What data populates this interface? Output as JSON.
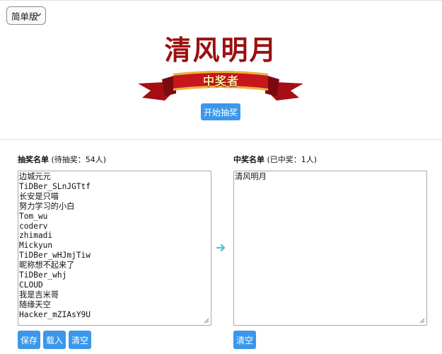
{
  "mode_select": {
    "value": "简单版"
  },
  "winner_display": {
    "name": "清风明月",
    "banner_text": "中奖者"
  },
  "start_button": "开始抽奖",
  "pool": {
    "title": "抽奖名单",
    "status": "(待抽奖：54人)",
    "entries": [
      "边城元元",
      "TiDBer_SLnJGTtf",
      "长安是只喵",
      "努力学习的小白",
      "Tom_wu",
      "coderv",
      "zhimadi",
      "Mickyun",
      "TiDBer_wHJmjTiw",
      "昵称想不起来了",
      "TiDBer_whj",
      "CLOUD",
      "我是吉米哥",
      "随缘天空",
      "Hacker_mZIAsY9U"
    ],
    "buttons": {
      "save": "保存",
      "load": "载入",
      "clear": "清空"
    }
  },
  "winners": {
    "title": "中奖名单",
    "status": "(已中奖：1人)",
    "entries": [
      "清风明月"
    ],
    "buttons": {
      "clear": "清空"
    }
  },
  "icons": {
    "select": "chevron-down-icon",
    "transfer": "arrow-right-icon",
    "resize": "resize-grip-icon"
  },
  "colors": {
    "accent": "#3a97ea",
    "title_red": "#9a1010",
    "ribbon_red": "#c8161d",
    "arrow": "#4cc3cf"
  }
}
